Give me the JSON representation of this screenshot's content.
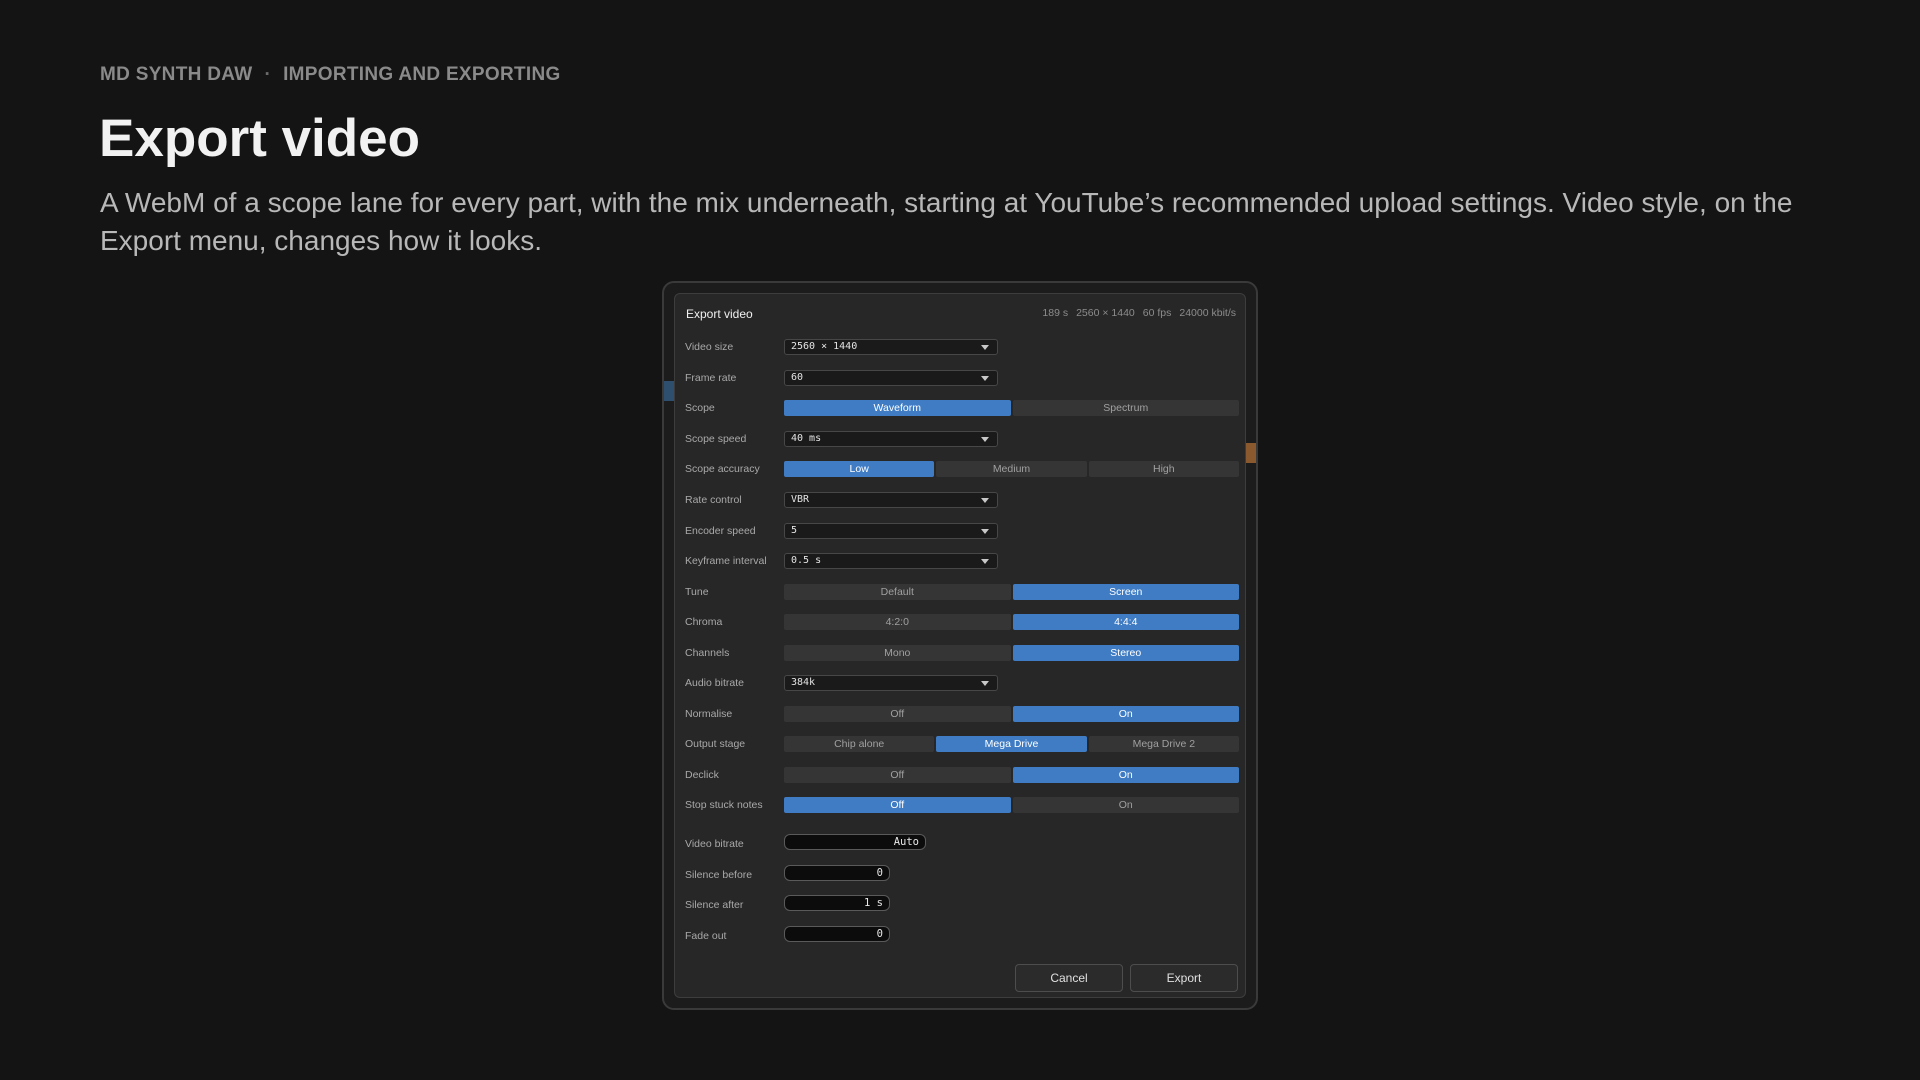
{
  "page": {
    "breadcrumb": {
      "app": "MD SYNTH DAW",
      "separator": "·",
      "section": "IMPORTING AND EXPORTING"
    },
    "title": "Export video",
    "description": "A WebM of a scope lane for every part, with the mix underneath, starting at YouTube’s recommended upload settings. Video style, on the Export menu, changes how it looks."
  },
  "dialog": {
    "title": "Export video",
    "info": {
      "duration": "189 s",
      "resolution": "2560 × 1440",
      "fps": "60 fps",
      "bitrate": "24000 kbit/s"
    },
    "video_size": {
      "label": "Video size",
      "value": "2560 × 1440"
    },
    "frame_rate": {
      "label": "Frame rate",
      "value": "60"
    },
    "scope": {
      "label": "Scope",
      "options": [
        "Waveform",
        "Spectrum"
      ],
      "selected": 0
    },
    "scope_speed": {
      "label": "Scope speed",
      "value": "40 ms"
    },
    "scope_accuracy": {
      "label": "Scope accuracy",
      "options": [
        "Low",
        "Medium",
        "High"
      ],
      "selected": 0
    },
    "rate_control": {
      "label": "Rate control",
      "value": "VBR"
    },
    "encoder_speed": {
      "label": "Encoder speed",
      "value": "5"
    },
    "keyframe_interval": {
      "label": "Keyframe interval",
      "value": "0.5 s"
    },
    "tune": {
      "label": "Tune",
      "options": [
        "Default",
        "Screen"
      ],
      "selected": 1
    },
    "chroma": {
      "label": "Chroma",
      "options": [
        "4:2:0",
        "4:4:4"
      ],
      "selected": 1
    },
    "channels": {
      "label": "Channels",
      "options": [
        "Mono",
        "Stereo"
      ],
      "selected": 1
    },
    "audio_bitrate": {
      "label": "Audio bitrate",
      "value": "384k"
    },
    "normalise": {
      "label": "Normalise",
      "options": [
        "Off",
        "On"
      ],
      "selected": 1
    },
    "output_stage": {
      "label": "Output stage",
      "options": [
        "Chip alone",
        "Mega Drive",
        "Mega Drive 2"
      ],
      "selected": 1
    },
    "declick": {
      "label": "Declick",
      "options": [
        "Off",
        "On"
      ],
      "selected": 1
    },
    "stop_stuck_notes": {
      "label": "Stop stuck notes",
      "options": [
        "Off",
        "On"
      ],
      "selected": 0
    },
    "video_bitrate": {
      "label": "Video bitrate",
      "value": "Auto"
    },
    "silence_before": {
      "label": "Silence before",
      "value": "0"
    },
    "silence_after": {
      "label": "Silence after",
      "value": "1 s"
    },
    "fade_out": {
      "label": "Fade out",
      "value": "0"
    },
    "cancel_label": "Cancel",
    "export_label": "Export"
  },
  "colors": {
    "accent": "#3f7cc4",
    "background": "#141414",
    "dialog": "#272727"
  }
}
